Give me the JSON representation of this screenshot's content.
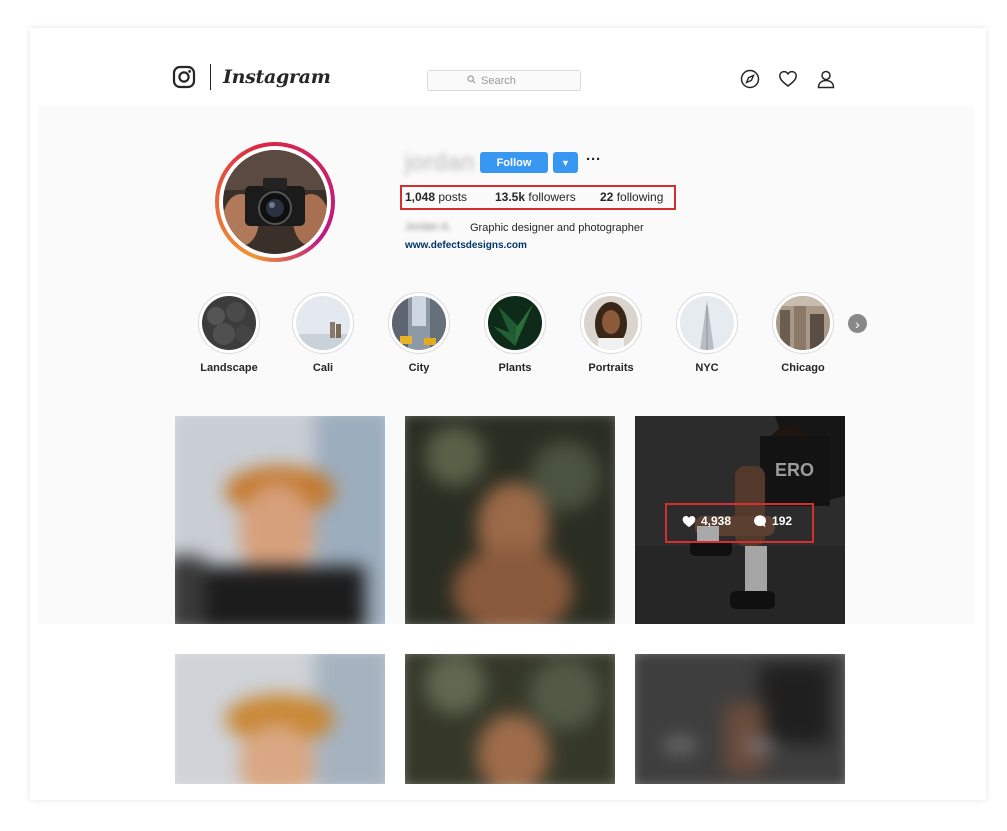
{
  "brand": {
    "name": "Instagram"
  },
  "search": {
    "placeholder": "Search"
  },
  "nav_icons": [
    "compass-icon",
    "heart-icon",
    "user-icon"
  ],
  "profile": {
    "username": "jordan",
    "follow_label": "Follow",
    "dropdown_glyph": "▼",
    "more_glyph": "···",
    "stats": {
      "posts_count": "1,048",
      "posts_label": "posts",
      "followers_count": "13.5k",
      "followers_label": "followers",
      "following_count": "22",
      "following_label": "following"
    },
    "full_name": "Jordan A.",
    "bio": "Graphic designer and photographer",
    "website": "www.defectsdesigns.com"
  },
  "highlights": [
    {
      "label": "Landscape"
    },
    {
      "label": "Cali"
    },
    {
      "label": "City"
    },
    {
      "label": "Plants"
    },
    {
      "label": "Portraits"
    },
    {
      "label": "NYC"
    },
    {
      "label": "Chicago"
    }
  ],
  "hover_post": {
    "likes": "4,938",
    "comments": "192"
  },
  "colors": {
    "accent": "#3897f0",
    "highlight_box": "#d32f2f",
    "link": "#003569"
  }
}
